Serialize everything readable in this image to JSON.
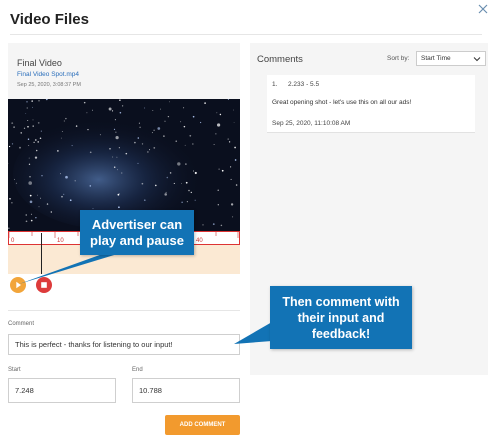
{
  "dialog": {
    "title": "Video Files"
  },
  "video": {
    "title": "Final Video",
    "file_name": "Final Video Spot.mp4",
    "date": "Sep 25, 2020, 3:08:37 PM"
  },
  "timeline": {
    "tick_labels": [
      "0",
      "10",
      "20",
      "30",
      "40"
    ]
  },
  "form": {
    "comment_label": "Comment",
    "comment_value": "This is perfect - thanks for listening to our input!",
    "start_label": "Start",
    "start_value": "7.248",
    "end_label": "End",
    "end_value": "10.788",
    "add_button_label": "ADD COMMENT"
  },
  "comments": {
    "title": "Comments",
    "sort_label": "Sort by:",
    "sort_value": "Start Time",
    "items": [
      {
        "index": "1.",
        "range": "2.233 - 5.5",
        "text": "Great opening shot - let's use this on all our ads!",
        "date": "Sep 25, 2020, 11:10:08 AM"
      }
    ]
  },
  "callouts": {
    "first": "Advertiser can play and pause",
    "second": "Then comment with their input and feedback!"
  },
  "colors": {
    "accent_orange": "#f29a2e",
    "callout_blue": "#1273b5",
    "stop_red": "#dd3b3b",
    "link_blue": "#2a6ebb"
  }
}
